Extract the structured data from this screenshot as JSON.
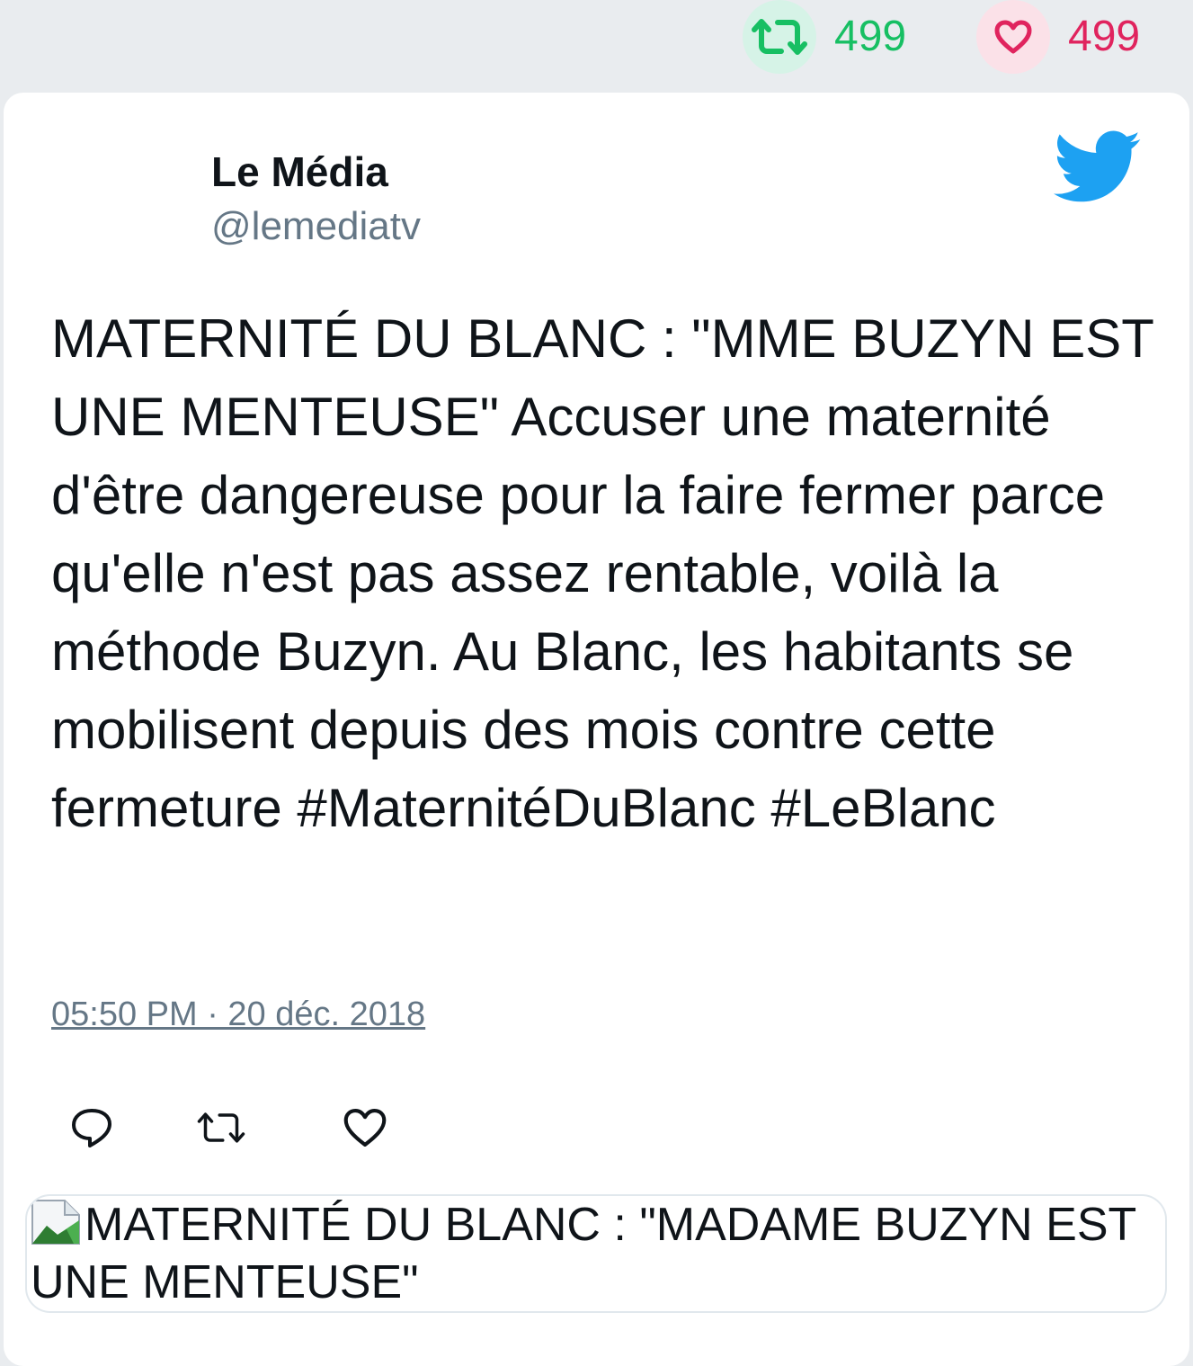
{
  "stats": {
    "retweet_count": "499",
    "like_count": "499"
  },
  "author": {
    "name": "Le Média",
    "handle": "@lemediatv"
  },
  "tweet": {
    "text": "MATERNITÉ DU BLANC : \"MME BUZYN EST UNE MENTEUSE\" Accuser une maternité d'être dangereuse pour la faire fermer parce qu'elle n'est pas assez rentable, voilà la méthode Buzyn. Au Blanc, les habitants se mobilisent depuis des mois contre cette fermeture #MaternitéDuBlanc #LeBlanc",
    "timestamp": "05:50 PM · 20 déc. 2018"
  },
  "link_card": {
    "image_alt": "MATERNITÉ DU BLANC : \"MADAME BUZYN EST UNE MENTEUSE\""
  },
  "icons": {
    "stat_retweet": "retweet-icon",
    "stat_like": "heart-icon",
    "brand": "twitter-bird-icon",
    "reply": "reply-icon",
    "retweet": "retweet-icon",
    "like": "heart-icon",
    "broken_image": "broken-image-icon"
  },
  "colors": {
    "retweet_green": "#17bf63",
    "like_red": "#e0245e",
    "twitter_blue": "#1da1f2",
    "muted_gray": "#657786"
  }
}
